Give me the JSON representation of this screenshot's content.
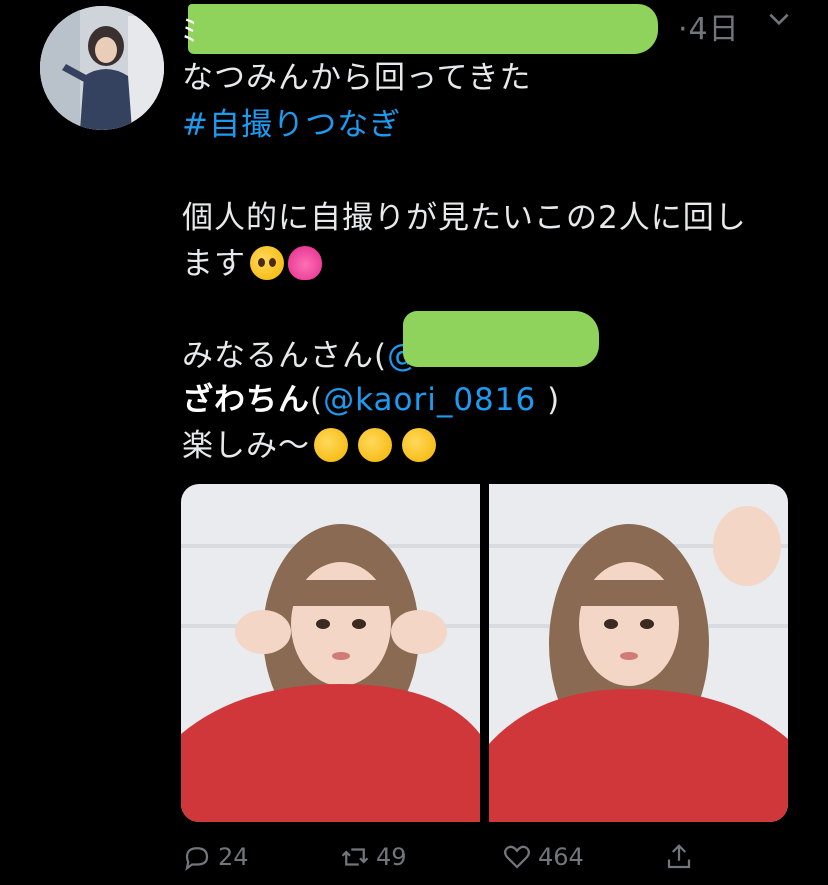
{
  "tweet": {
    "time": "·4日",
    "handle_peek": "ﾐ",
    "lines": {
      "l1": "なつみんから回ってきた",
      "hashtag": "#自撮りつなぎ",
      "l3a": "個人的に自撮りが見たいこの2人に回し",
      "l3b": "ます",
      "m1_name": "みなるんさん(",
      "m1_at": "@",
      "m2_name": "ざわちん",
      "m2_open": "(",
      "m2_handle": "@kaori_0816",
      "m2_close": " )",
      "l6": "楽しみ〜"
    },
    "emoji": {
      "pleading": "pleading-face",
      "heart": "beating-heart",
      "drool": "drooling-face"
    }
  },
  "actions": {
    "reply_count": "24",
    "retweet_count": "49",
    "like_count": "464"
  },
  "colors": {
    "link": "#1d9bf0",
    "muted": "#71767b",
    "redaction": "#8fd35c"
  }
}
